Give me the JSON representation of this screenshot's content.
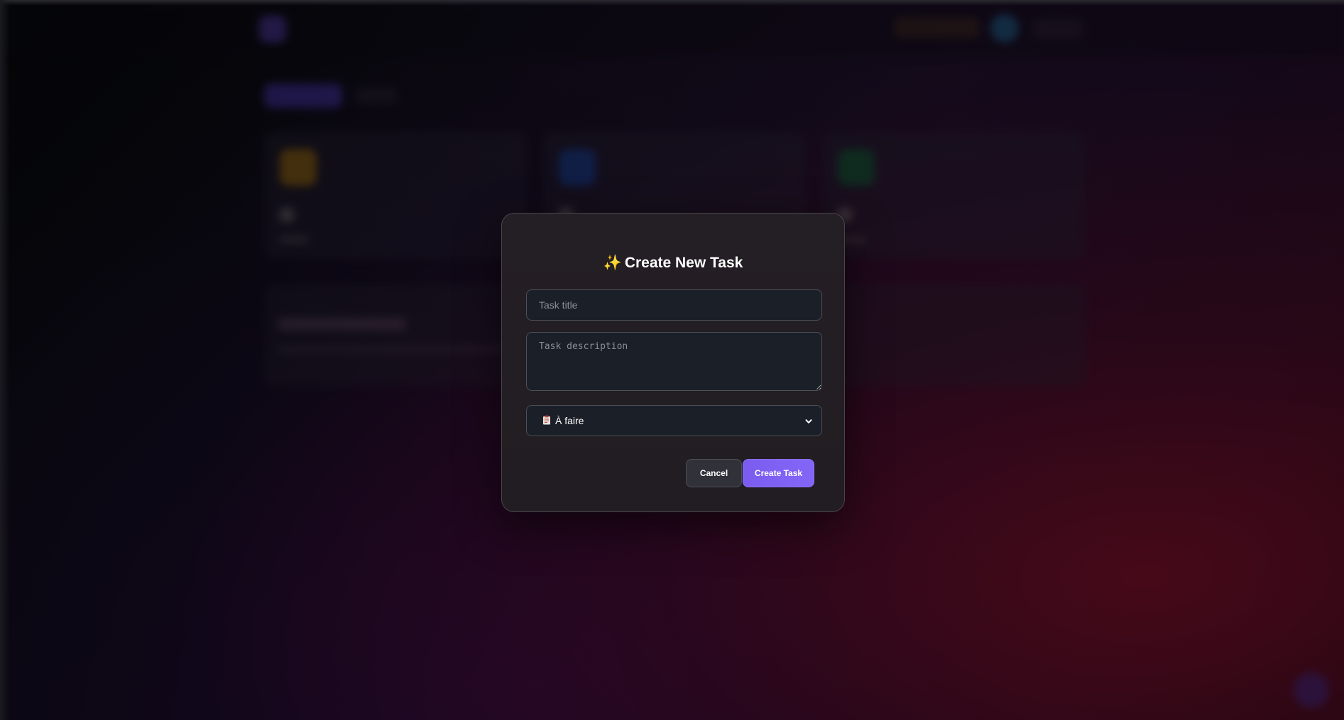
{
  "modal": {
    "sparkle_icon": "✨",
    "title": "Create New Task",
    "title_placeholder": "Task title",
    "title_value": "",
    "description_placeholder": "Task description",
    "description_value": "",
    "status": {
      "icon": "clipboard-icon",
      "selected_label": "À faire"
    },
    "cancel_label": "Cancel",
    "create_label": "Create Task"
  },
  "colors": {
    "accent": "#7a5cf0",
    "modal_bg": "#231e23",
    "input_bg": "#1b1f28"
  }
}
